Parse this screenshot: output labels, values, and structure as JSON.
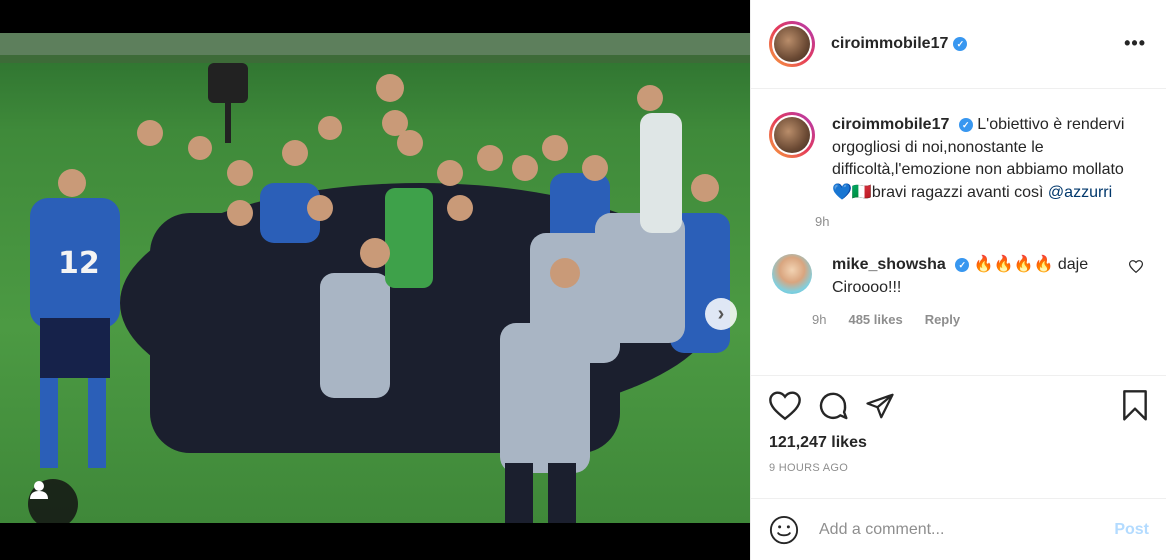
{
  "post": {
    "photo_id": "1233673555",
    "slide_count": 3,
    "active_slide": 1
  },
  "header": {
    "username": "ciroimmobile17",
    "verified_mark": "✓",
    "more_icon": "more-horizontal-icon"
  },
  "caption": {
    "username": "ciroimmobile17",
    "text": "L'obiettivo è rendervi orgogliosi di noi,nonostante le difficoltà,l'emozione non abbiamo mollato💙🇮🇹bravi ragazzi avanti così ",
    "mention": "@azzurri",
    "time": "9h"
  },
  "comments": [
    {
      "username": "mike_showsha",
      "text": " 🔥🔥🔥🔥 daje Ciroooo!!!",
      "time": "9h",
      "likes": "485 likes",
      "reply": "Reply"
    }
  ],
  "actions": {
    "likes": "121,247 likes",
    "ago": "9 HOURS AGO"
  },
  "add_comment": {
    "placeholder": "Add a comment...",
    "post_label": "Post"
  },
  "colors": {
    "accent": "#3897f0",
    "post_disabled": "#b3dbff",
    "pitch": "#4c9a43"
  }
}
